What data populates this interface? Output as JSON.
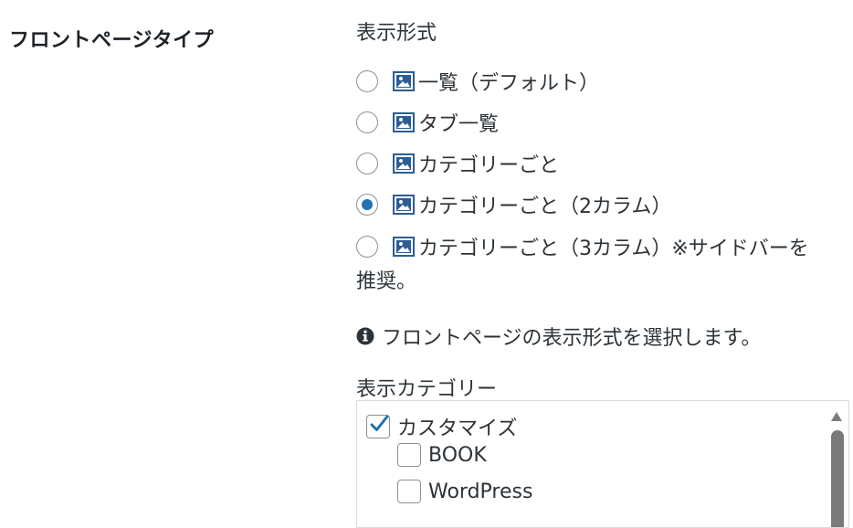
{
  "row": {
    "label": "フロントページタイプ"
  },
  "display_format": {
    "title": "表示形式",
    "options": [
      {
        "label": "一覧（デフォルト）",
        "checked": false
      },
      {
        "label": "タブ一覧",
        "checked": false
      },
      {
        "label": "カテゴリーごと",
        "checked": false
      },
      {
        "label": "カテゴリーごと（2カラム）",
        "checked": true
      },
      {
        "label": "カテゴリーごと（3カラム）※サイドバーを",
        "checked": false
      }
    ],
    "option_continuation": "推奨。",
    "help_icon": "info-icon",
    "help_text": "フロントページの表示形式を選択します。"
  },
  "display_categories": {
    "title": "表示カテゴリー",
    "items": [
      {
        "label": "カスタマイズ",
        "checked": true,
        "level": 0
      },
      {
        "label": "BOOK",
        "checked": false,
        "level": 1
      },
      {
        "label": "WordPress",
        "checked": false,
        "level": 1
      }
    ]
  },
  "colors": {
    "accent": "#2271b1",
    "text": "#2c3338",
    "border": "#8c8f94"
  }
}
